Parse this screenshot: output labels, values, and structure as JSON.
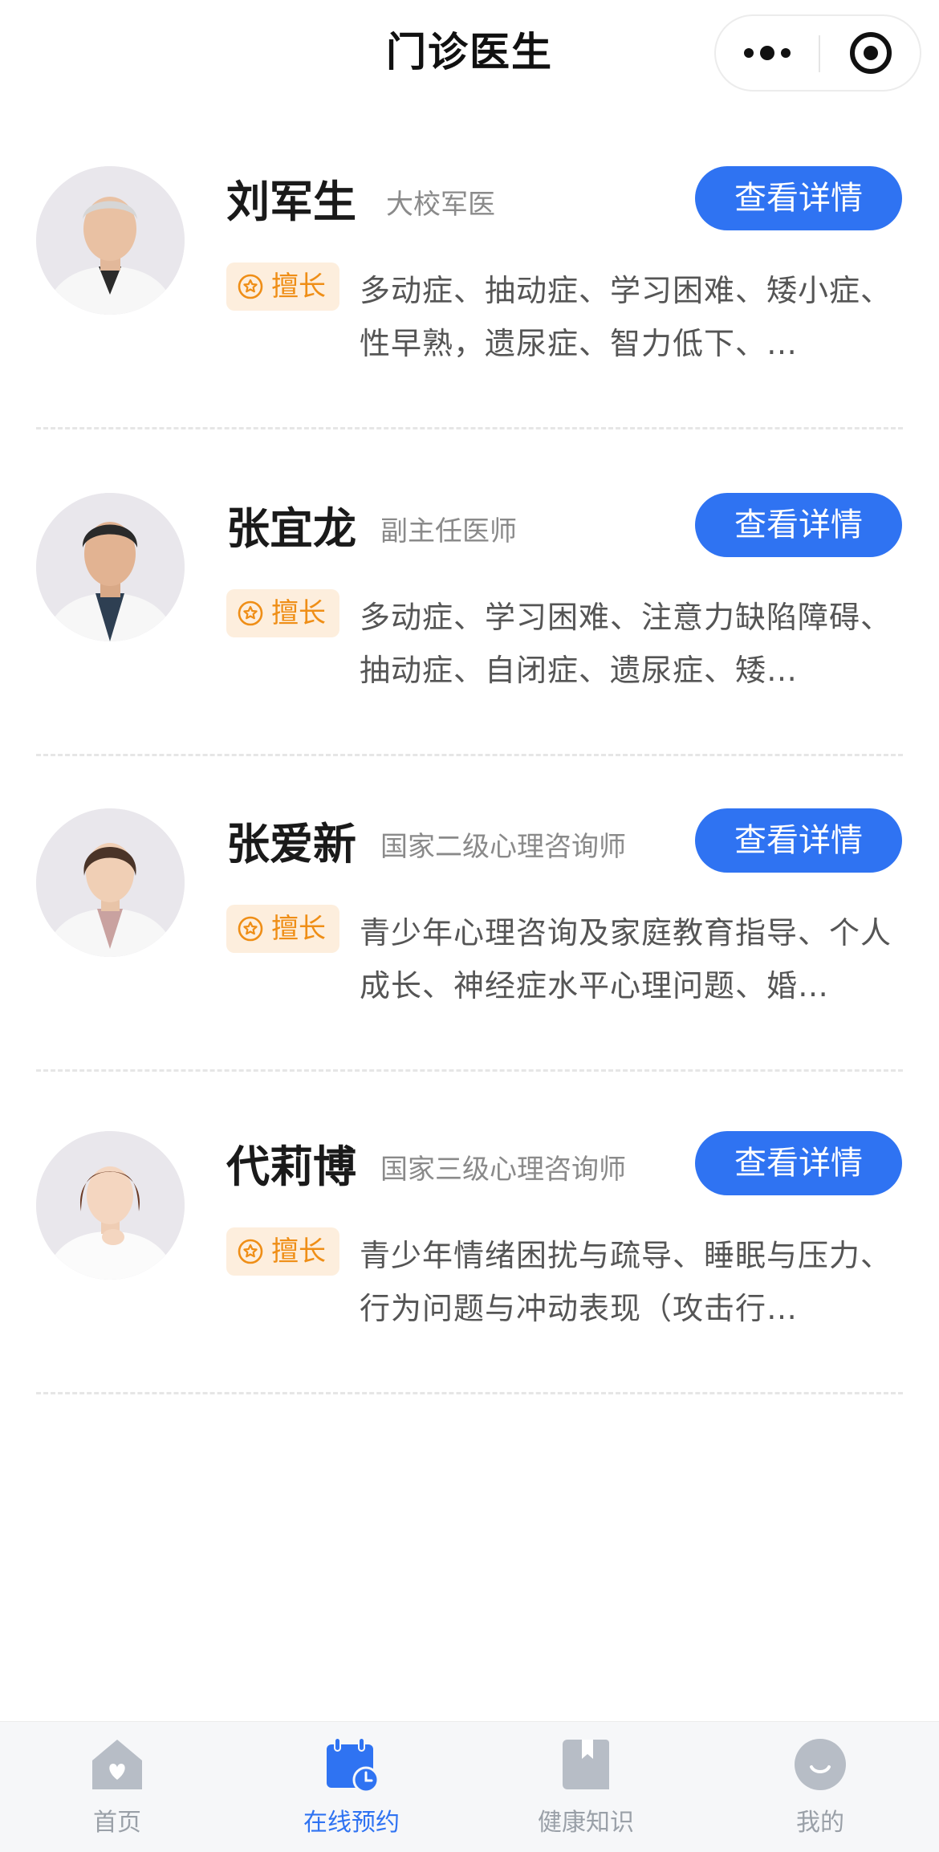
{
  "header": {
    "title": "门诊医生"
  },
  "capsule": {
    "more_icon": "more-dots-icon",
    "close_icon": "target-close-icon"
  },
  "doctors": [
    {
      "name": "刘军生",
      "title": "大校军医",
      "detail_label": "查看详情",
      "tag_label": "擅长",
      "specialty": "多动症、抽动症、学习困难、矮小症、性早熟，遗尿症、智力低下、…"
    },
    {
      "name": "张宜龙",
      "title": "副主任医师",
      "detail_label": "查看详情",
      "tag_label": "擅长",
      "specialty": "多动症、学习困难、注意力缺陷障碍、抽动症、自闭症、遗尿症、矮…"
    },
    {
      "name": "张爱新",
      "title": "国家二级心理咨询师",
      "detail_label": "查看详情",
      "tag_label": "擅长",
      "specialty": "青少年心理咨询及家庭教育指导、个人成长、神经症水平心理问题、婚…"
    },
    {
      "name": "代莉博",
      "title": "国家三级心理咨询师",
      "detail_label": "查看详情",
      "tag_label": "擅长",
      "specialty": "青少年情绪困扰与疏导、睡眠与压力、行为问题与冲动表现（攻击行…"
    }
  ],
  "tabbar": {
    "items": [
      {
        "label": "首页",
        "icon": "home-icon",
        "active": false
      },
      {
        "label": "在线预约",
        "icon": "calendar-clock-icon",
        "active": true
      },
      {
        "label": "健康知识",
        "icon": "bookmark-icon",
        "active": false
      },
      {
        "label": "我的",
        "icon": "smile-face-icon",
        "active": false
      }
    ]
  },
  "colors": {
    "primary": "#2f73f2",
    "tag_bg": "#fdeedd",
    "tag_text": "#ef8e16",
    "inactive_tab": "#9aa0a8"
  }
}
